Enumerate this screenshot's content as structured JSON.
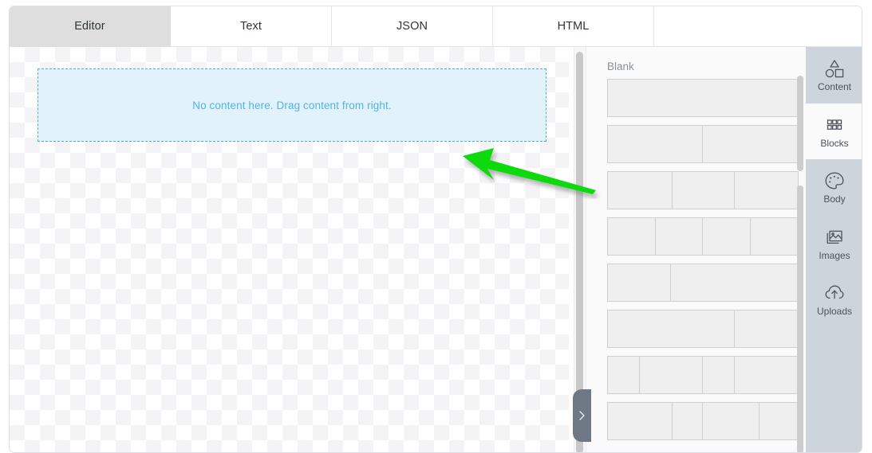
{
  "tabs": [
    {
      "label": "Editor",
      "active": true
    },
    {
      "label": "Text",
      "active": false
    },
    {
      "label": "JSON",
      "active": false
    },
    {
      "label": "HTML",
      "active": false
    }
  ],
  "editor": {
    "dropzone_text": "No content here. Drag content from right."
  },
  "collapse_handle": {
    "icon": "chevron-right-icon"
  },
  "blocks_panel": {
    "title": "Blank",
    "rows": [
      {
        "name": "block-1-column",
        "cells": [
          100
        ]
      },
      {
        "name": "block-2-column-even",
        "cells": [
          50,
          50
        ]
      },
      {
        "name": "block-3-column-even",
        "cells": [
          34,
          33,
          33
        ]
      },
      {
        "name": "block-4-column-even",
        "cells": [
          25,
          25,
          25,
          25
        ]
      },
      {
        "name": "block-2-column-1-3",
        "cells": [
          33,
          67
        ]
      },
      {
        "name": "block-2-column-3-1",
        "cells": [
          67,
          33
        ]
      },
      {
        "name": "block-4-column-mixed-a",
        "cells": [
          17,
          33,
          17,
          33
        ]
      },
      {
        "name": "block-4-column-mixed-b",
        "cells": [
          34,
          16,
          30,
          20
        ]
      }
    ]
  },
  "sidebar": {
    "items": [
      {
        "label": "Content",
        "icon": "shapes-icon",
        "active": false
      },
      {
        "label": "Blocks",
        "icon": "grid-icon",
        "active": true
      },
      {
        "label": "Body",
        "icon": "palette-icon",
        "active": false
      },
      {
        "label": "Images",
        "icon": "image-icon",
        "active": false
      },
      {
        "label": "Uploads",
        "icon": "cloud-upload-icon",
        "active": false
      }
    ]
  },
  "annotation": {
    "name": "green-arrow-pointing-left",
    "color": "#10d910"
  },
  "colors": {
    "accent_blue": "#53b3e3",
    "dropzone_bg": "#e2f2fb",
    "sidebar_bg": "#ced4dc",
    "panel_bg": "#fafafa",
    "active_tab_bg": "#dedede"
  }
}
